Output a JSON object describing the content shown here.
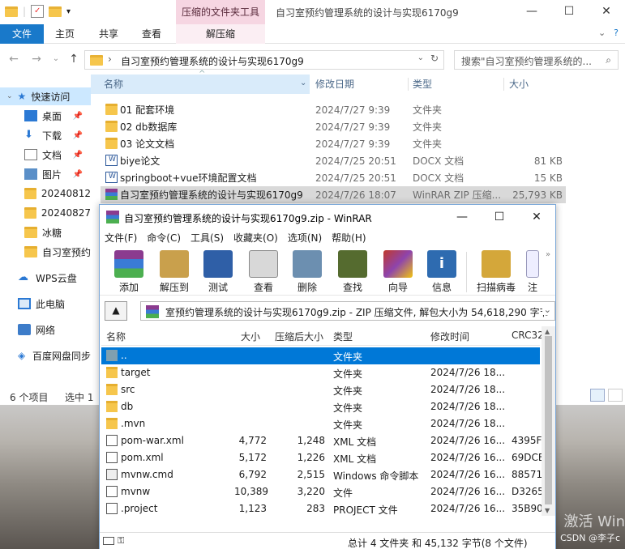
{
  "explorer": {
    "title": "自习室预约管理系统的设计与实现6170g9",
    "context_tab": "压缩的文件夹工具",
    "ribbon_tabs": [
      "文件",
      "主页",
      "共享",
      "查看"
    ],
    "context_ribbon_tab": "解压缩",
    "address": "自习室预约管理系统的设计与实现6170g9",
    "search_placeholder": "搜索\"自习室预约管理系统的...",
    "columns": [
      "名称",
      "修改日期",
      "类型",
      "大小"
    ],
    "sidebar": [
      {
        "label": "快速访问"
      },
      {
        "label": "桌面"
      },
      {
        "label": "下载"
      },
      {
        "label": "文档"
      },
      {
        "label": "图片"
      },
      {
        "label": "20240812"
      },
      {
        "label": "20240827"
      },
      {
        "label": "冰糖"
      },
      {
        "label": "自习室预约"
      },
      {
        "label": "WPS云盘"
      },
      {
        "label": "此电脑"
      },
      {
        "label": "网络"
      },
      {
        "label": "百度网盘同步"
      }
    ],
    "files": [
      {
        "name": "01 配套环境",
        "date": "2024/7/27 9:39",
        "type": "文件夹",
        "size": ""
      },
      {
        "name": "02 db数据库",
        "date": "2024/7/27 9:39",
        "type": "文件夹",
        "size": ""
      },
      {
        "name": "03 论文文档",
        "date": "2024/7/27 9:39",
        "type": "文件夹",
        "size": ""
      },
      {
        "name": "biye论文",
        "date": "2024/7/25 20:51",
        "type": "DOCX 文档",
        "size": "81 KB"
      },
      {
        "name": "springboot+vue环境配置文档",
        "date": "2024/7/25 20:51",
        "type": "DOCX 文档",
        "size": "15 KB"
      },
      {
        "name": "自习室预约管理系统的设计与实现6170g9",
        "date": "2024/7/26 18:07",
        "type": "WinRAR ZIP 压缩...",
        "size": "25,793 KB"
      }
    ],
    "status_count": "6 个项目",
    "status_selected": "选中 1"
  },
  "winrar": {
    "title": "自习室预约管理系统的设计与实现6170g9.zip - WinRAR",
    "menu": [
      "文件(F)",
      "命令(C)",
      "工具(S)",
      "收藏夹(O)",
      "选项(N)",
      "帮助(H)"
    ],
    "tools": [
      "添加",
      "解压到",
      "测试",
      "查看",
      "删除",
      "查找",
      "向导",
      "信息",
      "扫描病毒",
      "注"
    ],
    "path": "室预约管理系统的设计与实现6170g9.zip - ZIP 压缩文件, 解包大小为 54,618,290 字节",
    "columns": [
      "名称",
      "大小",
      "压缩后大小",
      "类型",
      "修改时间",
      "CRC32"
    ],
    "rows": [
      {
        "name": "..",
        "size": "",
        "packed": "",
        "type": "文件夹",
        "mtime": "",
        "crc": ""
      },
      {
        "name": "target",
        "size": "",
        "packed": "",
        "type": "文件夹",
        "mtime": "2024/7/26 18...",
        "crc": ""
      },
      {
        "name": "src",
        "size": "",
        "packed": "",
        "type": "文件夹",
        "mtime": "2024/7/26 18...",
        "crc": ""
      },
      {
        "name": "db",
        "size": "",
        "packed": "",
        "type": "文件夹",
        "mtime": "2024/7/26 18...",
        "crc": ""
      },
      {
        "name": ".mvn",
        "size": "",
        "packed": "",
        "type": "文件夹",
        "mtime": "2024/7/26 18...",
        "crc": ""
      },
      {
        "name": "pom-war.xml",
        "size": "4,772",
        "packed": "1,248",
        "type": "XML 文档",
        "mtime": "2024/7/26 16...",
        "crc": "4395F"
      },
      {
        "name": "pom.xml",
        "size": "5,172",
        "packed": "1,226",
        "type": "XML 文档",
        "mtime": "2024/7/26 16...",
        "crc": "69DCE"
      },
      {
        "name": "mvnw.cmd",
        "size": "6,792",
        "packed": "2,515",
        "type": "Windows 命令脚本",
        "mtime": "2024/7/26 16...",
        "crc": "88571"
      },
      {
        "name": "mvnw",
        "size": "10,389",
        "packed": "3,220",
        "type": "文件",
        "mtime": "2024/7/26 16...",
        "crc": "D3265"
      },
      {
        "name": ".project",
        "size": "1,123",
        "packed": "283",
        "type": "PROJECT 文件",
        "mtime": "2024/7/26 16...",
        "crc": "35B90"
      }
    ],
    "status": "总计 4 文件夹 和 45,132 字节(8 个文件)"
  },
  "overlay": {
    "watermark": "激活 Win",
    "csdn": "CSDN @李子c"
  },
  "colors": {
    "accent": "#0078d7",
    "file_tab": "#1979ca",
    "context_tab": "#f6d6e2"
  }
}
